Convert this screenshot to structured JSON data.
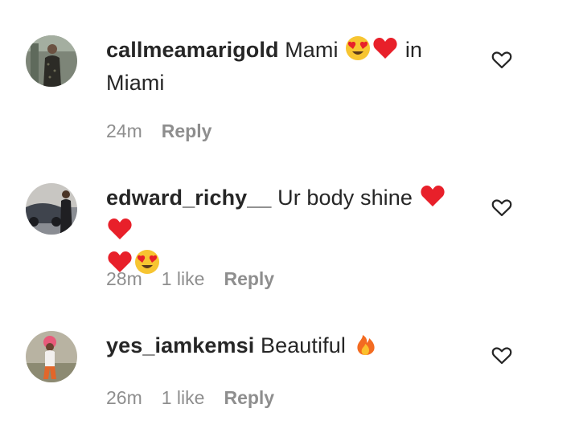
{
  "comments": [
    {
      "username": "callmeamarigold",
      "text_before": "Mami",
      "text_after": "in Miami",
      "emojis_mid": [
        "heart-eyes",
        "red-heart"
      ],
      "time": "24m",
      "likes": "",
      "reply_label": "Reply"
    },
    {
      "username": "edward_richy__",
      "text_before": "Ur body shine",
      "emojis_mid": [
        "red-heart",
        "red-heart",
        "red-heart",
        "heart-eyes"
      ],
      "time": "28m",
      "likes": "1 like",
      "reply_label": "Reply"
    },
    {
      "username": "yes_iamkemsi",
      "text_before": "Beautiful",
      "emojis_mid": [
        "fire"
      ],
      "time": "26m",
      "likes": "1 like",
      "reply_label": "Reply"
    }
  ],
  "colors": {
    "text": "#262626",
    "meta": "#8e8e8e",
    "heart": "#e8202a",
    "emoji_face": "#f7c531"
  }
}
